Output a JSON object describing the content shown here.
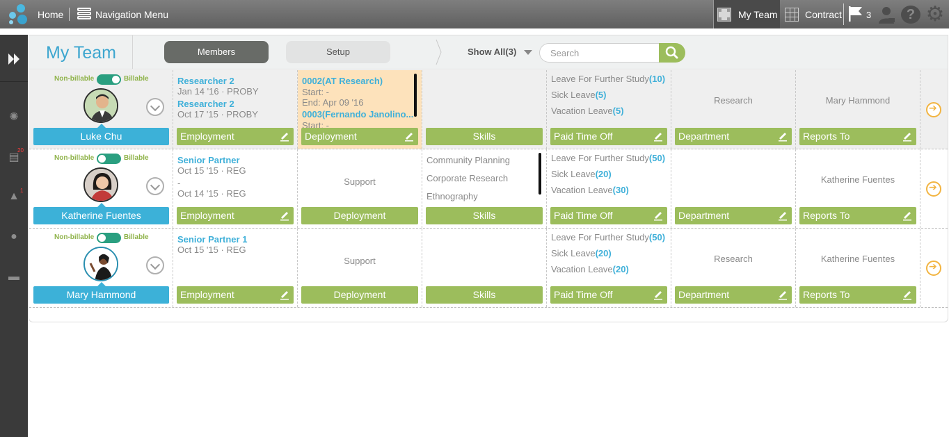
{
  "topbar": {
    "home_label": "Home",
    "nav_menu_label": "Navigation Menu",
    "my_team_label": "My Team",
    "contract_label": "Contract",
    "flag_count": "3"
  },
  "rail": {
    "badge_documents": "20",
    "badge_stamp": "1"
  },
  "header": {
    "title": "My Team",
    "tab_members": "Members",
    "tab_setup": "Setup",
    "show_all": "Show All(3)",
    "search_placeholder": "Search"
  },
  "labels": {
    "non_billable": "Non-billable",
    "billable": "Billable",
    "employment": "Employment",
    "deployment": "Deployment",
    "skills": "Skills",
    "paid_time_off": "Paid Time Off",
    "department": "Department",
    "reports_to": "Reports To"
  },
  "members": [
    {
      "name": "Luke Chu",
      "billable": true,
      "employment": [
        {
          "title": "Researcher 2",
          "detail": "Jan 14 '16 · PROBY"
        },
        {
          "title": "Researcher 2",
          "detail": "Oct 17 '15 · PROBY"
        }
      ],
      "deployment": {
        "first_title": "0002(AT Research)",
        "first_start": "Start: -",
        "first_end": "End: Apr 09 '16",
        "second_title": "0003(Fernando Janolino...",
        "second_start": "Start: -"
      },
      "leave": [
        {
          "name": "Leave For Further Study",
          "count": "(10)"
        },
        {
          "name": "Sick Leave",
          "count": "(5)"
        },
        {
          "name": "Vacation Leave",
          "count": "(5)"
        }
      ],
      "department": "Research",
      "reports_to": "Mary Hammond"
    },
    {
      "name": "Katherine Fuentes",
      "billable": true,
      "employment": [
        {
          "title": "Senior Partner",
          "detail": "Oct 15 '15 · REG"
        }
      ],
      "employment_extra": [
        "-",
        "Oct 14 '15 · REG"
      ],
      "deployment_text": "Support",
      "skills": [
        "Community Planning",
        "Corporate Research",
        "Ethnography"
      ],
      "leave": [
        {
          "name": "Leave For Further Study",
          "count": "(50)"
        },
        {
          "name": "Sick Leave",
          "count": "(20)"
        },
        {
          "name": "Vacation Leave",
          "count": "(30)"
        }
      ],
      "department": "",
      "reports_to": "Katherine Fuentes"
    },
    {
      "name": "Mary Hammond",
      "billable": true,
      "employment": [
        {
          "title": "Senior Partner 1",
          "detail": "Oct 15 '15 · REG"
        }
      ],
      "deployment_text": "Support",
      "leave": [
        {
          "name": "Leave For Further Study",
          "count": "(50)"
        },
        {
          "name": "Sick Leave",
          "count": "(20)"
        },
        {
          "name": "Vacation Leave",
          "count": "(20)"
        }
      ],
      "department": "Research",
      "reports_to": "Katherine Fuentes"
    }
  ],
  "colors": {
    "accent_blue": "#3cb1d8",
    "action_green": "#9cbd5c",
    "toggle_teal": "#2a9f80",
    "deploy_highlight": "#fde2bb",
    "next_arrow": "#f2b441"
  }
}
